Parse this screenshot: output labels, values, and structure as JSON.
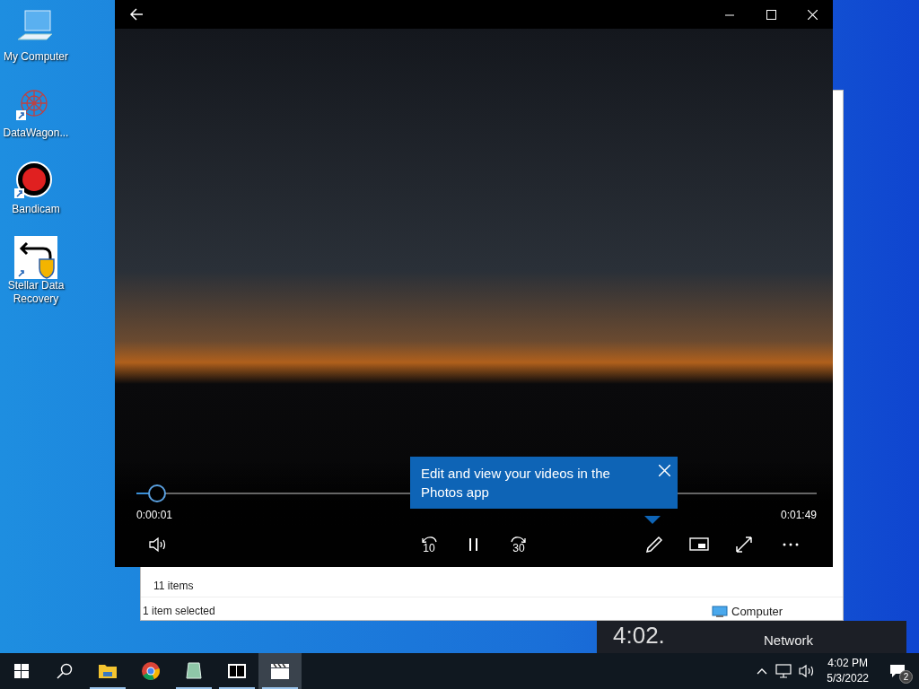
{
  "desktop_icons": [
    {
      "label": "My Computer",
      "kind": "computer"
    },
    {
      "label": "DataWagon...",
      "kind": "datawagon"
    },
    {
      "label": "Bandicam",
      "kind": "record"
    },
    {
      "label": "Stellar Data Recovery",
      "kind": "stellar"
    }
  ],
  "explorer": {
    "item_count": "11 items",
    "selection": "1 item selected",
    "location": "Computer"
  },
  "widget_behind": {
    "time": "4:02.",
    "label": "Network"
  },
  "player": {
    "seek": {
      "level": 0.03
    },
    "elapsed": "0:00:01",
    "duration": "0:01:49",
    "rewind": "10",
    "forward": "30",
    "playing": true,
    "tip": {
      "text": "Edit and view your videos in the Photos app"
    }
  },
  "taskbar": {
    "apps": [
      {
        "kind": "folder",
        "running": true,
        "active": false
      },
      {
        "kind": "browser",
        "running": false,
        "active": false
      },
      {
        "kind": "notepad",
        "running": true,
        "active": false
      },
      {
        "kind": "archive",
        "running": true,
        "active": false
      },
      {
        "kind": "clapper",
        "running": true,
        "active": true
      }
    ],
    "clock_time": "4:02 PM",
    "clock_date": "5/3/2022",
    "notification_count": "2"
  }
}
